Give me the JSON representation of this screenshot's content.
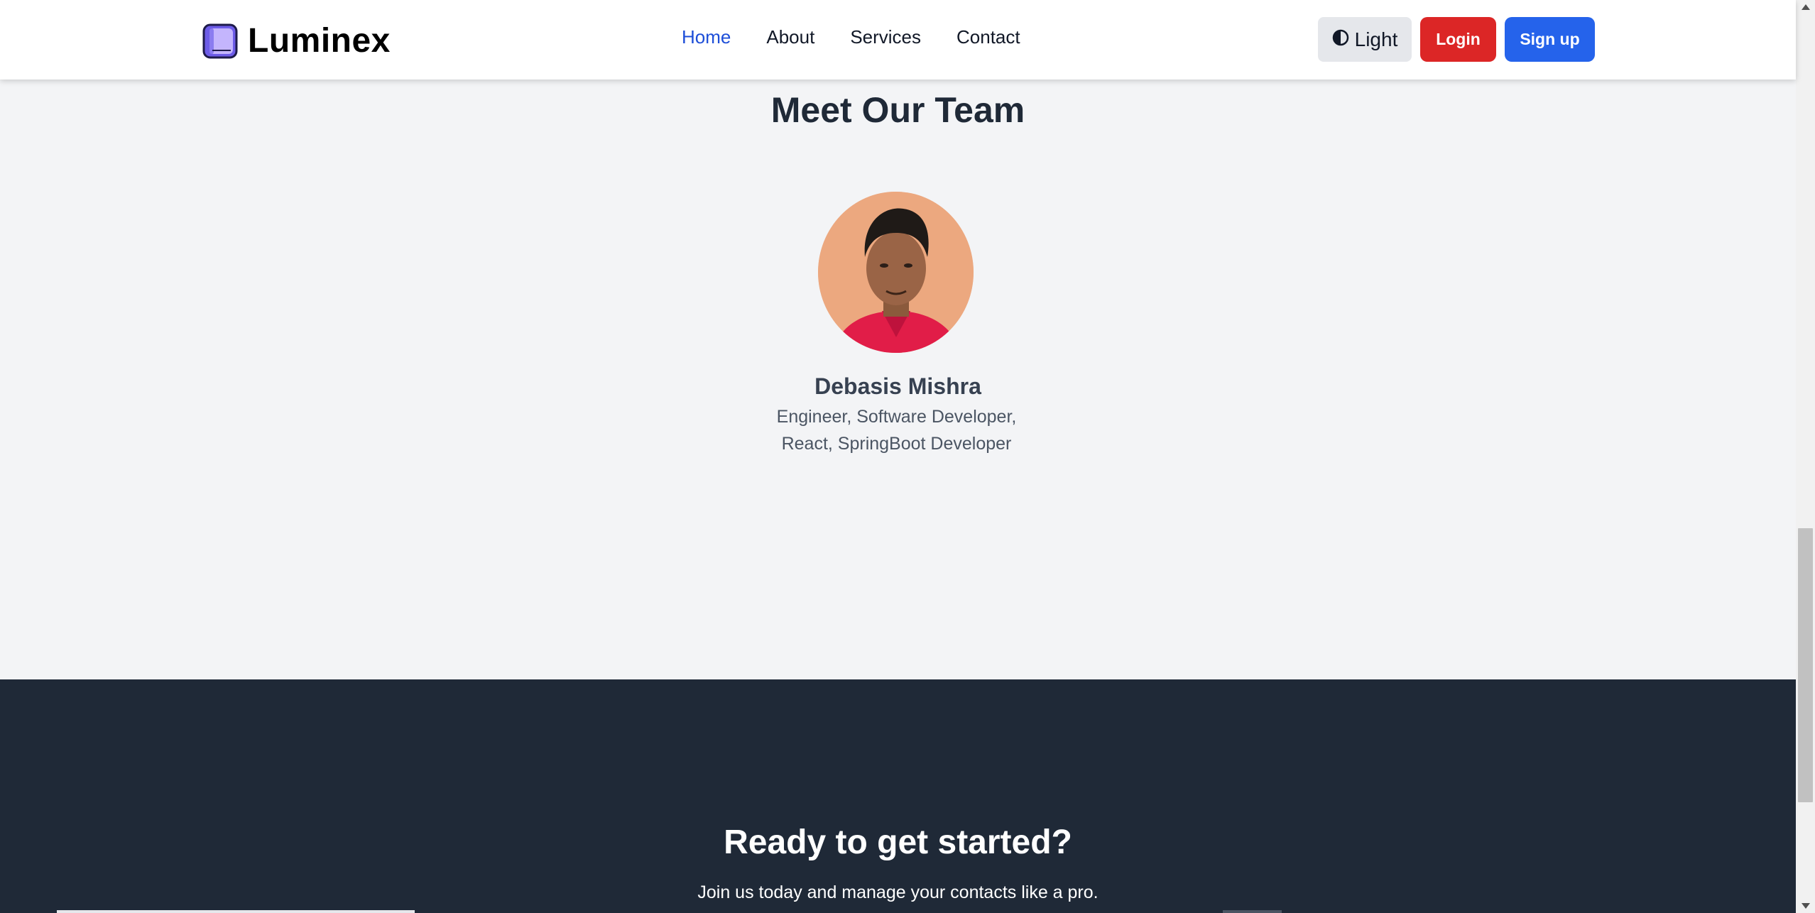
{
  "header": {
    "brand_name": "Luminex",
    "logo_icon": "book-icon",
    "nav": [
      {
        "label": "Home",
        "active": true
      },
      {
        "label": "About",
        "active": false
      },
      {
        "label": "Services",
        "active": false
      },
      {
        "label": "Contact",
        "active": false
      }
    ],
    "theme_toggle_icon": "contrast-icon",
    "theme_toggle_label": "Light",
    "login_label": "Login",
    "signup_label": "Sign up"
  },
  "team": {
    "title": "Meet Our Team",
    "member": {
      "name": "Debasis Mishra",
      "role_line1": "Engineer, Software Developer,",
      "role_line2": "React, SpringBoot Developer"
    }
  },
  "cta": {
    "title": "Ready to get started?",
    "subtitle": "Join us today and manage your contacts like a pro."
  },
  "colors": {
    "accent_blue": "#2563eb",
    "login_red": "#dc2626",
    "active_nav": "#1d4ed8",
    "dark_section": "#1f2937",
    "light_section": "#f3f4f6"
  }
}
